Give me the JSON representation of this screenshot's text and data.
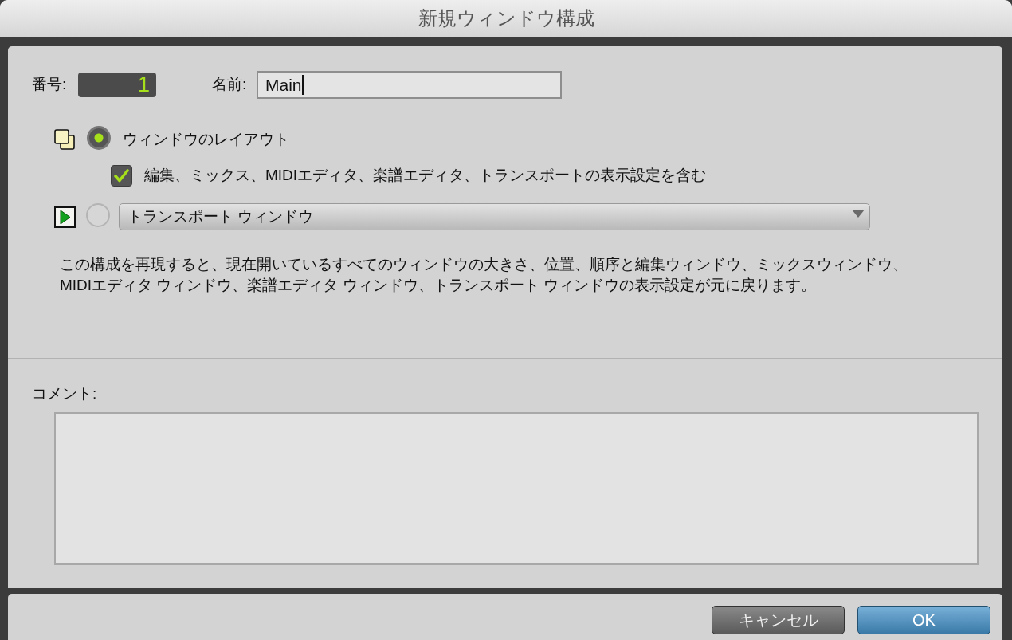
{
  "window": {
    "title": "新規ウィンドウ構成"
  },
  "number": {
    "label": "番号:",
    "value": "1"
  },
  "name": {
    "label": "名前:",
    "value": "Main",
    "focused": true
  },
  "options": [
    {
      "kind": "layout",
      "selected": true,
      "label": "ウィンドウのレイアウト",
      "include": {
        "checked": true,
        "label": "編集、ミックス、MIDIエディタ、楽譜エディタ、トランスポートの表示設定を含む"
      }
    },
    {
      "kind": "window",
      "selected": false,
      "value": "トランスポート ウィンドウ"
    }
  ],
  "description": [
    "この構成を再現すると、現在開いているすべてのウィンドウの大きさ、位置、順序と編集ウィンドウ、ミックスウィンドウ、",
    "MIDIエディタ ウィンドウ、楽譜エディタ ウィンドウ、トランスポート ウィンドウの表示設定が元に戻ります。"
  ],
  "comment": {
    "label": "コメント:"
  },
  "buttons": [
    {
      "kind": "cancel",
      "label": "キャンセル"
    },
    {
      "kind": "default",
      "label": "OK"
    }
  ]
}
